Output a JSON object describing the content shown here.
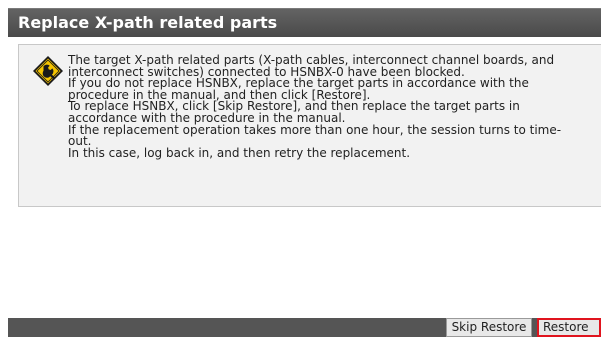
{
  "dialog": {
    "title": "Replace X-path related parts",
    "message_lines": [
      "The target X-path related parts (X-path cables, interconnect channel boards, and",
      "interconnect switches) connected to HSNBX-0 have been blocked.",
      "If you do not replace HSNBX, replace the target parts in accordance with the",
      "procedure in the manual, and then click [Restore].",
      "To replace HSNBX, click [Skip Restore], and then replace the target parts in",
      "accordance with the procedure in the manual.",
      "If the replacement operation takes more than one hour, the session turns to time-",
      "out.",
      "In this case, log back in, and then retry the replacement."
    ],
    "icon": "warning-icon"
  },
  "footer": {
    "skip_restore_label": "Skip Restore",
    "restore_label": "Restore"
  },
  "colors": {
    "title_bar": "#555555",
    "title_text": "#ffffff",
    "message_bg": "#f2f2f2",
    "warning_fill": "#f5c400",
    "highlight_border": "#e0141e"
  }
}
